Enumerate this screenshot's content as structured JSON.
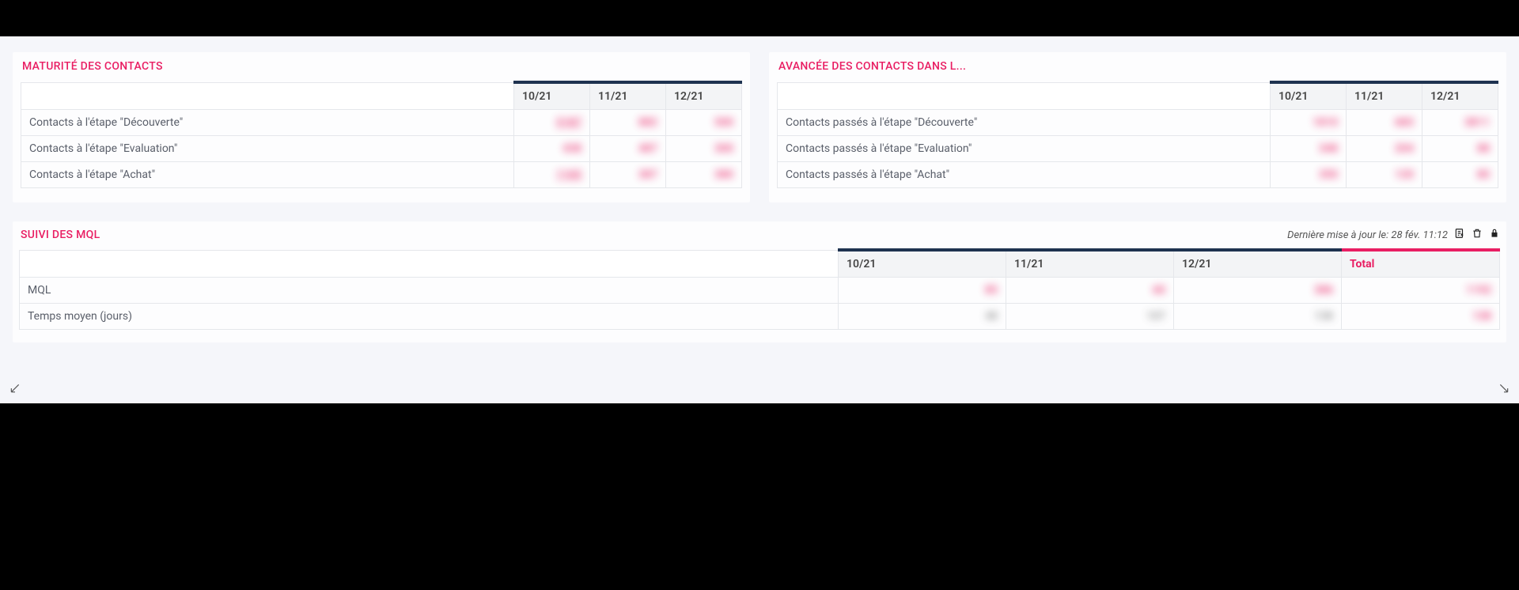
{
  "panels": {
    "maturite": {
      "title": "MATURITÉ DES CONTACTS",
      "periods": [
        "10/21",
        "11/21",
        "12/21"
      ],
      "rows": [
        {
          "label": "Contacts à l'étape \"Découverte\"",
          "values": [
            "5187",
            "882",
            "500"
          ]
        },
        {
          "label": "Contacts à l'étape \"Evaluation\"",
          "values": [
            "438",
            "487",
            "300"
          ]
        },
        {
          "label": "Contacts à l'étape \"Achat\"",
          "values": [
            "1165",
            "387",
            "380"
          ]
        }
      ]
    },
    "avancee": {
      "title": "AVANCÉE DES CONTACTS DANS L...",
      "periods": [
        "10/21",
        "11/21",
        "12/21"
      ],
      "rows": [
        {
          "label": "Contacts passés à l'étape \"Découverte\"",
          "values": [
            "1810",
            "683",
            "3811"
          ]
        },
        {
          "label": "Contacts passés à l'étape \"Evaluation\"",
          "values": [
            "348",
            "204",
            "88"
          ]
        },
        {
          "label": "Contacts passés à l'étape \"Achat\"",
          "values": [
            "350",
            "120",
            "80"
          ]
        }
      ]
    },
    "suivi": {
      "title": "SUIVI DES MQL",
      "last_update": "Dernière mise à jour le: 28 fév. 11:12",
      "periods": [
        "10/21",
        "11/21",
        "12/21"
      ],
      "total_label": "Total",
      "rows": [
        {
          "label": "MQL",
          "values": [
            "85",
            "60",
            "386"
          ],
          "total": "1192",
          "kind": "pink"
        },
        {
          "label": "Temps moyen (jours)",
          "values": [
            "48",
            "107",
            "138"
          ],
          "total": "138",
          "kind": "gray"
        }
      ]
    }
  },
  "icons": {
    "export": "⎘",
    "trash": "🗑",
    "lock": "🔒",
    "expand_left": "↙",
    "expand_right": "↘"
  }
}
